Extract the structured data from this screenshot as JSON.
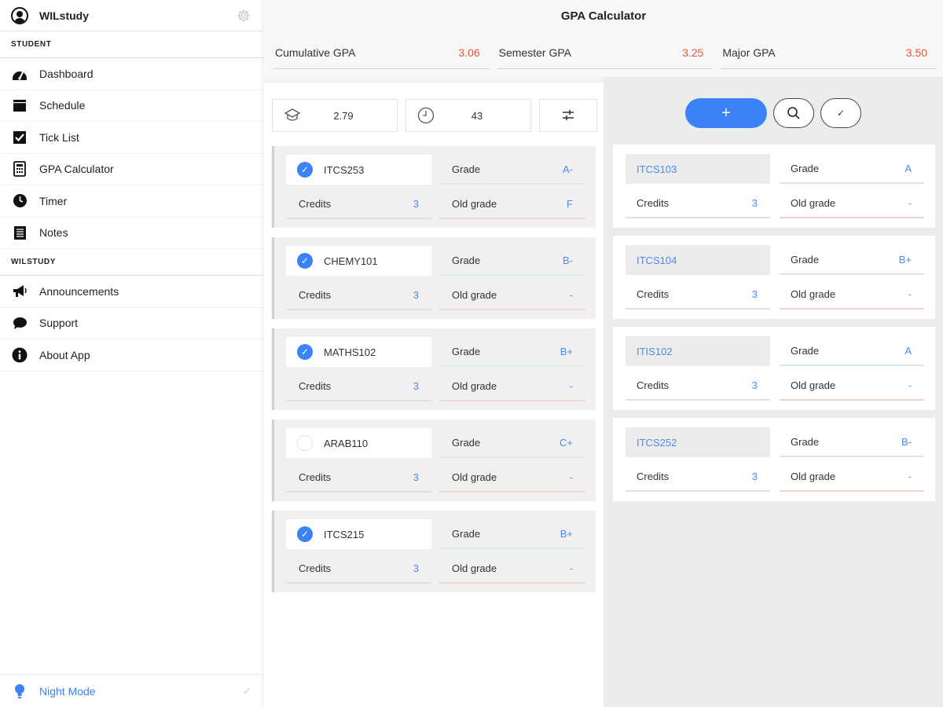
{
  "sidebar": {
    "app_name": "WILstudy",
    "section_student": "STUDENT",
    "section_wilstudy": "WILSTUDY",
    "items": [
      {
        "label": "Dashboard",
        "icon": "dashboard-gauge-icon"
      },
      {
        "label": "Schedule",
        "icon": "calendar-icon"
      },
      {
        "label": "Tick List",
        "icon": "checkbox-icon"
      },
      {
        "label": "GPA Calculator",
        "icon": "calculator-icon"
      },
      {
        "label": "Timer",
        "icon": "clock-icon"
      },
      {
        "label": "Notes",
        "icon": "notes-icon"
      }
    ],
    "items2": [
      {
        "label": "Announcements",
        "icon": "megaphone-icon"
      },
      {
        "label": "Support",
        "icon": "chat-bubble-icon"
      },
      {
        "label": "About App",
        "icon": "info-icon"
      }
    ],
    "footer_label": "Night Mode",
    "footer_check": "✓"
  },
  "header": {
    "title": "GPA Calculator"
  },
  "gpa_summary": [
    {
      "label": "Cumulative GPA",
      "value": "3.06"
    },
    {
      "label": "Semester GPA",
      "value": "3.25"
    },
    {
      "label": "Major GPA",
      "value": "3.50"
    }
  ],
  "toolbar": {
    "gpa_value": "2.79",
    "hours_value": "43"
  },
  "courses": [
    {
      "name": "ITCS253",
      "checked": true,
      "grade_label": "Grade",
      "grade": "A-",
      "credits_label": "Credits",
      "credits": "3",
      "old_label": "Old grade",
      "old_grade": "F"
    },
    {
      "name": "CHEMY101",
      "checked": true,
      "grade_label": "Grade",
      "grade": "B-",
      "credits_label": "Credits",
      "credits": "3",
      "old_label": "Old grade",
      "old_grade": "-"
    },
    {
      "name": "MATHS102",
      "checked": true,
      "grade_label": "Grade",
      "grade": "B+",
      "credits_label": "Credits",
      "credits": "3",
      "old_label": "Old grade",
      "old_grade": "-"
    },
    {
      "name": "ARAB110",
      "checked": false,
      "grade_label": "Grade",
      "grade": "C+",
      "credits_label": "Credits",
      "credits": "3",
      "old_label": "Old grade",
      "old_grade": "-"
    },
    {
      "name": "ITCS215",
      "checked": true,
      "grade_label": "Grade",
      "grade": "B+",
      "credits_label": "Credits",
      "credits": "3",
      "old_label": "Old grade",
      "old_grade": "-"
    }
  ],
  "actions": {
    "add_label": "+",
    "confirm_label": "✓"
  },
  "planned_courses": [
    {
      "name": "ITCS103",
      "grade_label": "Grade",
      "grade": "A",
      "credits_label": "Credits",
      "credits": "3",
      "old_label": "Old grade",
      "old_grade": "-"
    },
    {
      "name": "ITCS104",
      "grade_label": "Grade",
      "grade": "B+",
      "credits_label": "Credits",
      "credits": "3",
      "old_label": "Old grade",
      "old_grade": "-"
    },
    {
      "name": "ITIS102",
      "grade_label": "Grade",
      "grade": "A",
      "credits_label": "Credits",
      "credits": "3",
      "old_label": "Old grade",
      "old_grade": "-"
    },
    {
      "name": "ITCS252",
      "grade_label": "Grade",
      "grade": "B-",
      "credits_label": "Credits",
      "credits": "3",
      "old_label": "Old grade",
      "old_grade": "-"
    }
  ],
  "colors": {
    "accent": "#3b82f6",
    "gpa_value": "#e8553a",
    "grade_value": "#4a8af4"
  }
}
